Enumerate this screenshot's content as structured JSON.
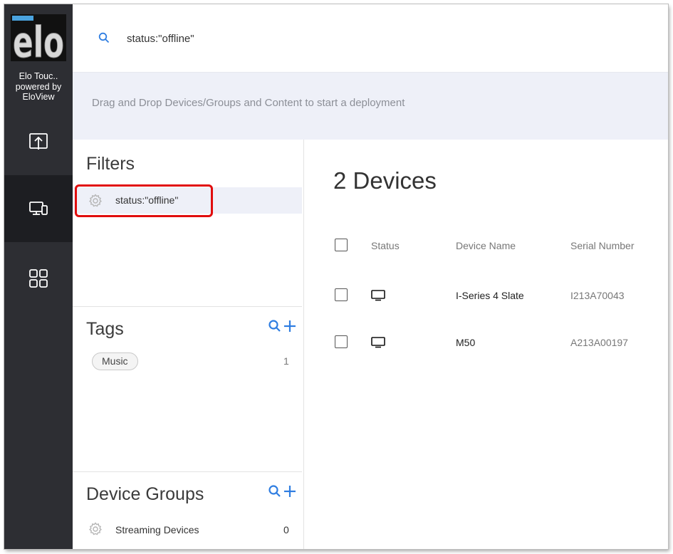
{
  "sidebar": {
    "logo_text": "elo",
    "brand_line1": "Elo Touc..",
    "brand_line2": "powered by",
    "brand_line3": "EloView",
    "items": [
      {
        "icon": "upload-icon",
        "active": false
      },
      {
        "icon": "devices-icon",
        "active": true
      },
      {
        "icon": "apps-grid-icon",
        "active": false
      }
    ]
  },
  "search": {
    "query": "status:\"offline\"",
    "icon": "search-icon"
  },
  "deploy": {
    "hint": "Drag and Drop Devices/Groups and Content to start a deployment"
  },
  "filters": {
    "title": "Filters",
    "items": [
      {
        "label": "status:\"offline\"",
        "icon": "gear-icon"
      }
    ]
  },
  "tags": {
    "title": "Tags",
    "items": [
      {
        "label": "Music",
        "count": "1"
      }
    ]
  },
  "device_groups": {
    "title": "Device Groups",
    "items": [
      {
        "label": "Streaming Devices",
        "count": "0",
        "icon": "gear-icon"
      }
    ]
  },
  "devices": {
    "title": "2 Devices",
    "columns": {
      "status": "Status",
      "name": "Device Name",
      "serial": "Serial Number"
    },
    "rows": [
      {
        "name": "I-Series 4 Slate",
        "serial": "I213A70043",
        "status_icon": "monitor-icon"
      },
      {
        "name": "M50",
        "serial": "A213A00197",
        "status_icon": "monitor-icon"
      }
    ]
  },
  "colors": {
    "sidebar_bg": "#2d2e33",
    "sidebar_active": "#1d1e22",
    "accent_blue": "#2e7de1",
    "highlight_red": "#e10d0d",
    "banner_bg": "#eef0f8"
  }
}
